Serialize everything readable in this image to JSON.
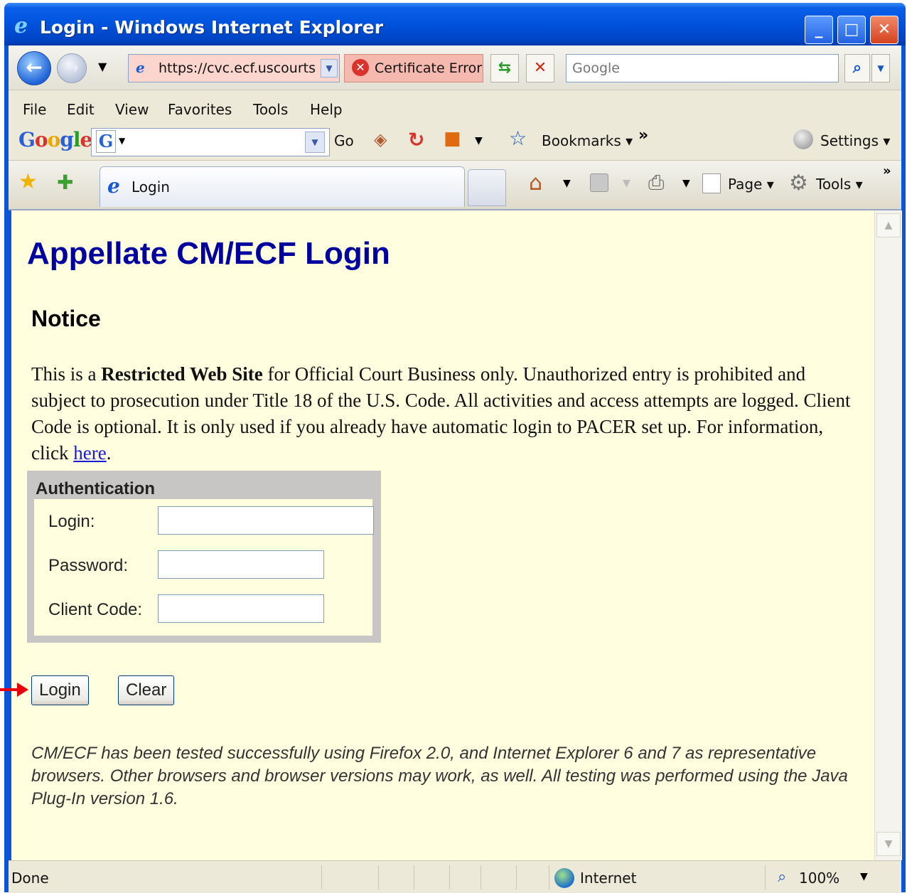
{
  "window": {
    "title": "Login - Windows Internet Explorer",
    "minimize": "_",
    "maximize": "□",
    "close": "✕"
  },
  "address_bar": {
    "url": "https://cvc.ecf.uscourts",
    "cert_error": "Certificate Error",
    "search_placeholder": "Google"
  },
  "menu": [
    "File",
    "Edit",
    "View",
    "Favorites",
    "Tools",
    "Help"
  ],
  "google_toolbar": {
    "logo": "Google",
    "go": "Go",
    "bookmarks": "Bookmarks",
    "settings": "Settings"
  },
  "tab": {
    "label": "Login",
    "page_menu": "Page",
    "tools_menu": "Tools"
  },
  "page": {
    "title": "Appellate CM/ECF Login",
    "notice_heading": "Notice",
    "notice_prefix": "This is a ",
    "notice_bold": "Restricted Web Site",
    "notice_body": " for Official Court Business only. Unauthorized entry is prohibited and subject to prosecution under Title 18 of the U.S. Code. All activities and access attempts are logged. Client Code is optional. It is only used if you already have automatic login to PACER set up. For information, click ",
    "notice_link": "here",
    "notice_suffix": ".",
    "auth_legend": "Authentication",
    "login_label": "Login:",
    "password_label": "Password:",
    "client_code_label": "Client Code:",
    "login_button": "Login",
    "clear_button": "Clear",
    "note": "CM/ECF has been tested successfully using Firefox 2.0, and Internet Explorer 6 and 7 as representative browsers. Other browsers and browser versions may work, as well. All testing was performed using the Java Plug-In version 1.6."
  },
  "status_bar": {
    "status": "Done",
    "zone": "Internet",
    "zoom": "100%"
  }
}
